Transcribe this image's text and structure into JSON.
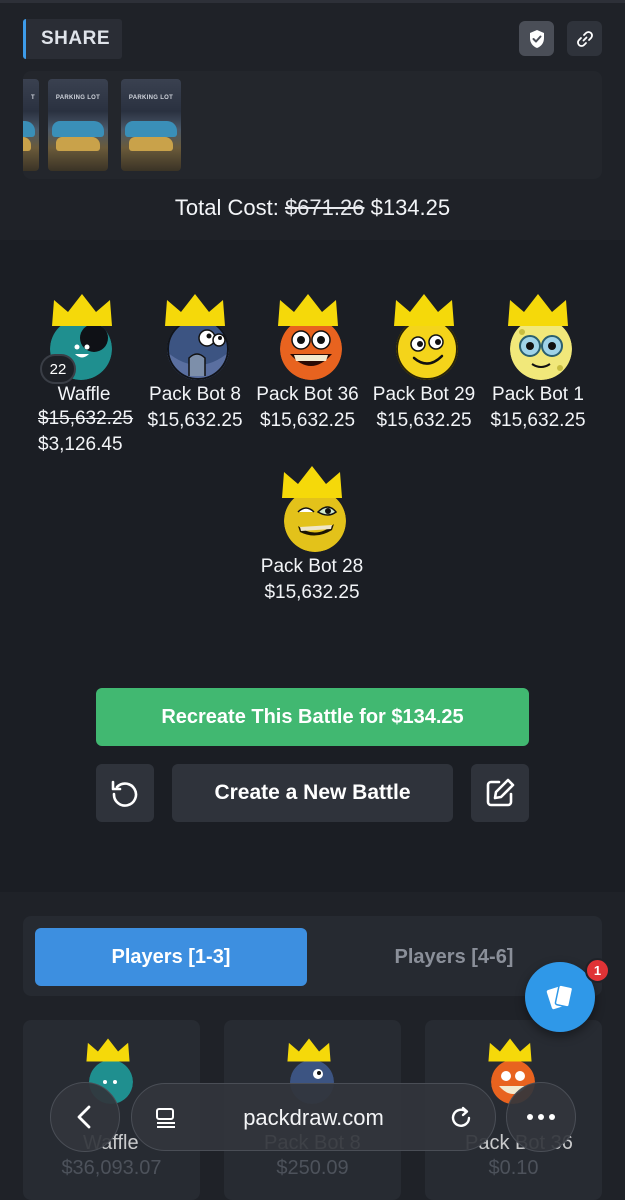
{
  "header": {
    "share_label": "SHARE",
    "shield_icon": "shield-check-icon",
    "link_icon": "link-icon"
  },
  "packs": [
    {
      "label": "T"
    },
    {
      "label": "PARKING LOT"
    },
    {
      "label": "PARKING LOT"
    }
  ],
  "total_cost": {
    "label": "Total Cost:",
    "original": "$671.26",
    "discounted": "$134.25"
  },
  "players": [
    {
      "name": "Waffle",
      "level": "22",
      "original_value": "$15,632.25",
      "value": "$3,126.45"
    },
    {
      "name": "Pack Bot 8",
      "value": "$15,632.25"
    },
    {
      "name": "Pack Bot 36",
      "value": "$15,632.25"
    },
    {
      "name": "Pack Bot 29",
      "value": "$15,632.25"
    },
    {
      "name": "Pack Bot 1",
      "value": "$15,632.25"
    },
    {
      "name": "Pack Bot 28",
      "value": "$15,632.25"
    }
  ],
  "actions": {
    "recreate_label": "Recreate This Battle for $134.25",
    "new_battle_label": "Create a New Battle",
    "recreate_color": "#41b871"
  },
  "tabs": [
    {
      "label": "Players [1-3]",
      "active": true
    },
    {
      "label": "Players [4-6]",
      "active": false
    }
  ],
  "player_cards": [
    {
      "name": "Waffle",
      "value": "$36,093.07"
    },
    {
      "name": "Pack Bot 8",
      "value": "$250.09"
    },
    {
      "name": "Pack Bot 36",
      "value": "$0.10"
    }
  ],
  "fab": {
    "badge": "1",
    "icon": "cards-icon"
  },
  "browser": {
    "url": "packdraw.com"
  },
  "colors": {
    "accent": "#3d8fe0",
    "background": "#1b1e24",
    "crown": "#f5d90a"
  }
}
